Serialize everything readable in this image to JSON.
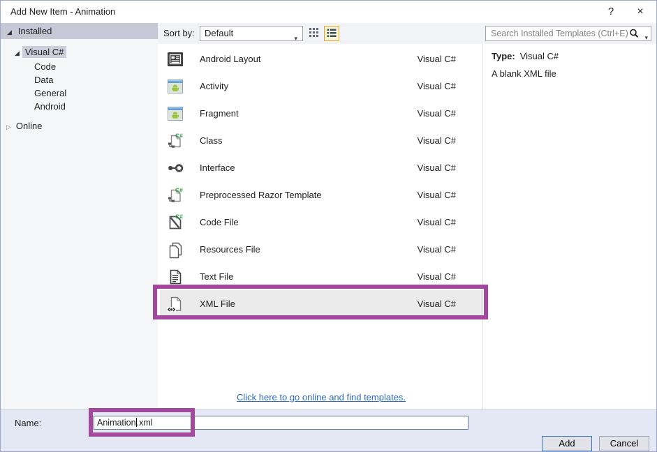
{
  "window": {
    "title": "Add New Item - Animation",
    "help_glyph": "?",
    "close_glyph": "×"
  },
  "sidebar": {
    "installed_label": "Installed",
    "visual_csharp_label": "Visual C#",
    "children": [
      "Code",
      "Data",
      "General",
      "Android"
    ],
    "online_label": "Online",
    "expanded_glyph": "◢",
    "collapsed_glyph": "▷"
  },
  "toolbar": {
    "sort_by_label": "Sort by:",
    "sort_by_value": "Default",
    "search_placeholder": "Search Installed Templates (Ctrl+E)"
  },
  "templates": {
    "items": [
      {
        "name": "Android Layout",
        "language": "Visual C#",
        "icon": "android-layout",
        "selected": false
      },
      {
        "name": "Activity",
        "language": "Visual C#",
        "icon": "android-app",
        "selected": false
      },
      {
        "name": "Fragment",
        "language": "Visual C#",
        "icon": "android-app",
        "selected": false
      },
      {
        "name": "Class",
        "language": "Visual C#",
        "icon": "csharp-class",
        "selected": false
      },
      {
        "name": "Interface",
        "language": "Visual C#",
        "icon": "interface",
        "selected": false
      },
      {
        "name": "Preprocessed Razor Template",
        "language": "Visual C#",
        "icon": "csharp-class",
        "selected": false
      },
      {
        "name": "Code File",
        "language": "Visual C#",
        "icon": "code-file",
        "selected": false
      },
      {
        "name": "Resources File",
        "language": "Visual C#",
        "icon": "resources-file",
        "selected": false
      },
      {
        "name": "Text File",
        "language": "Visual C#",
        "icon": "text-file",
        "selected": false
      },
      {
        "name": "XML File",
        "language": "Visual C#",
        "icon": "xml-file",
        "selected": true
      }
    ],
    "online_link": "Click here to go online and find templates."
  },
  "details": {
    "type_label": "Type:",
    "type_value": "Visual C#",
    "description": "A blank XML file"
  },
  "footer": {
    "name_label": "Name:",
    "name_value": "Animation.xml",
    "name_before_caret": "Animation",
    "name_after_caret": ".xml",
    "add_label": "Add",
    "cancel_label": "Cancel"
  },
  "colors": {
    "annotation_highlight": "#A2499E",
    "selected_row_bg": "#EBEBEB",
    "tree_selection_bg": "#CCCEDB",
    "category_header_bg": "#C6C8D6",
    "footer_bg": "#E4E8F4",
    "link_color": "#2E68C0",
    "view_button_selected_bg": "#FCF4CE",
    "view_button_selected_border": "#DCA43B",
    "add_button_border": "#3A77BE"
  }
}
